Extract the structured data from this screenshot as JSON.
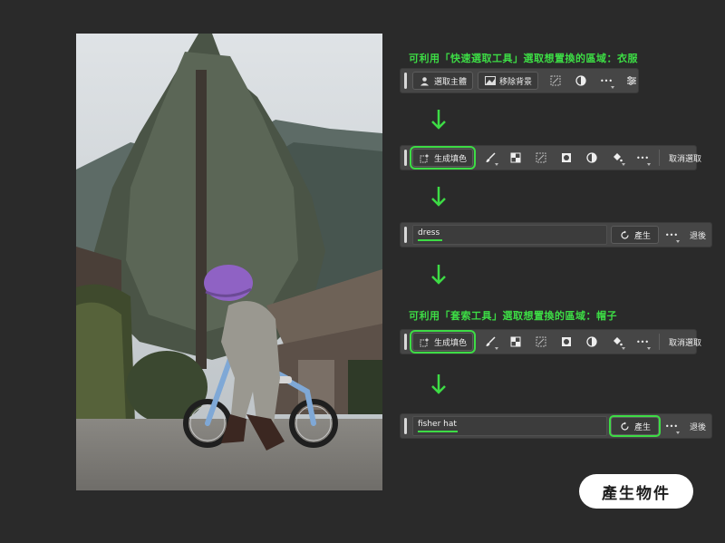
{
  "captions": {
    "step1": "可利用「快速選取工具」選取想置換的區域：衣服",
    "step4": "可利用「套索工具」選取想置換的區域：帽子"
  },
  "toolbar1": {
    "select_subject": "選取主體",
    "remove_background": "移除背景",
    "more": "•••"
  },
  "toolbar2": {
    "generative_fill": "生成填色",
    "more": "•••",
    "deselect": "取消選取"
  },
  "prompt1": {
    "value": "dress",
    "generate": "產生",
    "more": "•••",
    "back": "退後"
  },
  "toolbar4": {
    "generative_fill": "生成填色",
    "more": "•••",
    "deselect": "取消選取"
  },
  "prompt2": {
    "value": "fisher hat",
    "generate": "產生",
    "more": "•••",
    "back": "退後"
  },
  "badge": {
    "label": "產生物件"
  },
  "colors": {
    "highlight": "#3ddc45",
    "background": "#2a2a2a",
    "toolbar": "#464646"
  }
}
